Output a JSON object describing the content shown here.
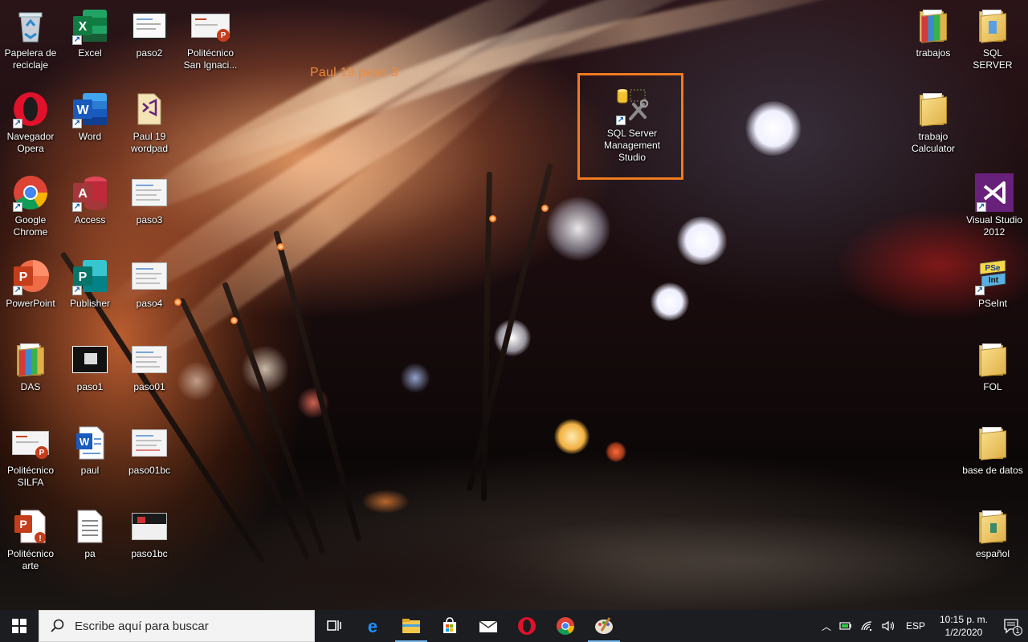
{
  "desktop": {
    "annotation": "Paul 19 paso 3",
    "left_icons": [
      {
        "label": "Papelera de reciclaje",
        "icon": "recycle-bin-icon"
      },
      {
        "label": "Excel",
        "icon": "excel-icon"
      },
      {
        "label": "paso2",
        "icon": "image-file-icon"
      },
      {
        "label": "Politécnico San Ignaci...",
        "icon": "powerpoint-file-icon"
      },
      {
        "label": "Navegador Opera",
        "icon": "opera-icon"
      },
      {
        "label": "Word",
        "icon": "word-icon"
      },
      {
        "label": "Paul 19 wordpad",
        "icon": "visual-studio-file-icon"
      },
      {
        "label": "Google Chrome",
        "icon": "chrome-icon"
      },
      {
        "label": "Access",
        "icon": "access-icon"
      },
      {
        "label": "paso3",
        "icon": "image-file-icon"
      },
      {
        "label": "PowerPoint",
        "icon": "powerpoint-icon"
      },
      {
        "label": "Publisher",
        "icon": "publisher-icon"
      },
      {
        "label": "paso4",
        "icon": "image-file-icon"
      },
      {
        "label": "DAS",
        "icon": "winrar-folder-icon"
      },
      {
        "label": "paso1",
        "icon": "image-file-icon"
      },
      {
        "label": "paso01",
        "icon": "image-file-icon"
      },
      {
        "label": "Politécnico SILFA",
        "icon": "powerpoint-file-icon"
      },
      {
        "label": "paul",
        "icon": "word-file-icon"
      },
      {
        "label": "paso01bc",
        "icon": "image-file-icon"
      },
      {
        "label": "Politécnico arte",
        "icon": "powerpoint-file-icon"
      },
      {
        "label": "pa",
        "icon": "text-file-icon"
      },
      {
        "label": "paso1bc",
        "icon": "image-file-icon"
      }
    ],
    "center_icon": {
      "label": "SQL Server Management Studio",
      "icon": "ssms-icon"
    },
    "right_icons": [
      {
        "label": "trabajos",
        "icon": "winrar-folder-icon"
      },
      {
        "label": "SQL SERVER",
        "icon": "folder-icon"
      },
      {
        "label": "trabajo Calculator",
        "icon": "folder-icon"
      },
      {
        "label": "Visual Studio 2012",
        "icon": "visual-studio-icon"
      },
      {
        "label": "PSeInt",
        "icon": "pseint-icon"
      },
      {
        "label": "FOL",
        "icon": "folder-icon"
      },
      {
        "label": "base de datos",
        "icon": "folder-icon"
      },
      {
        "label": "español",
        "icon": "folder-icon"
      }
    ]
  },
  "taskbar": {
    "search_placeholder": "Escribe aquí para buscar",
    "pinned": [
      "task-view-icon",
      "edge-icon",
      "file-explorer-icon",
      "store-icon",
      "mail-icon",
      "opera-icon",
      "chrome-icon",
      "paint-icon"
    ],
    "tray": {
      "language": "ESP",
      "time": "10:15 p. m.",
      "date": "1/2/2020",
      "notification_count": "1"
    }
  },
  "colors": {
    "annotation": "#f08a3a",
    "highlight_border": "#f07b20",
    "taskbar_bg": "#1c1d21"
  }
}
